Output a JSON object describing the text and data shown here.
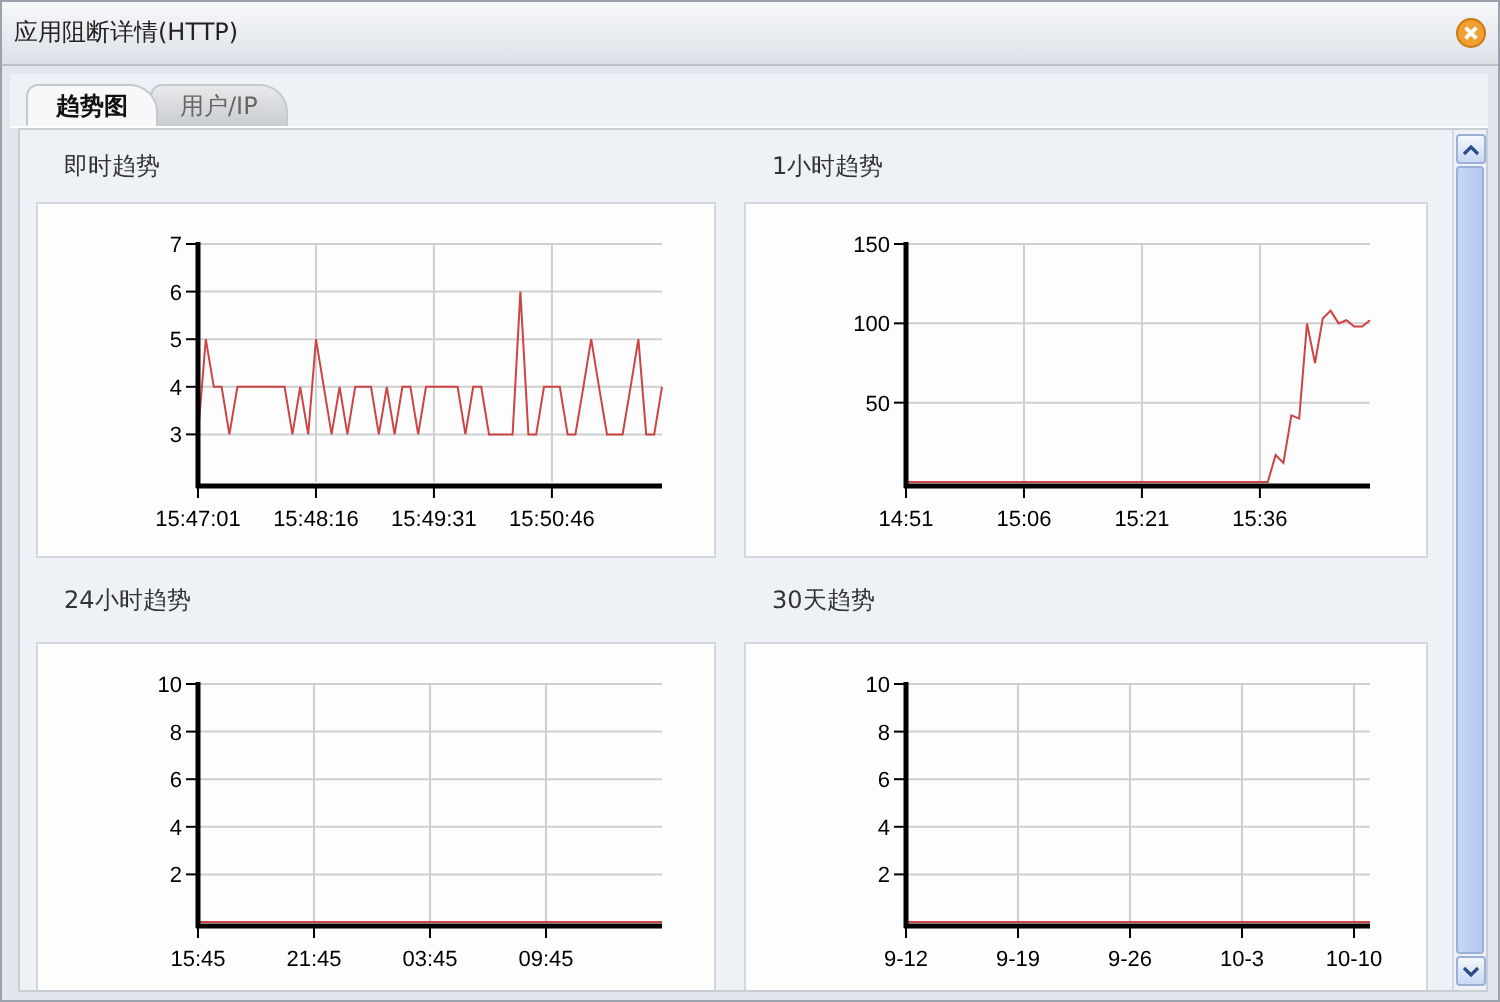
{
  "window": {
    "title": "应用阻断详情(HTTP)"
  },
  "tabs": [
    {
      "label": "趋势图",
      "selected": true
    },
    {
      "label": "用户/IP",
      "selected": false
    }
  ],
  "panels": [
    {
      "title": "即时趋势",
      "chart_data": {
        "type": "line",
        "categories": [
          "15:47:01",
          null,
          null,
          null,
          null,
          null,
          null,
          null,
          null,
          null,
          null,
          null,
          null,
          null,
          null,
          "15:48:16",
          null,
          null,
          null,
          null,
          null,
          null,
          null,
          null,
          null,
          null,
          null,
          null,
          null,
          null,
          "15:49:31",
          null,
          null,
          null,
          null,
          null,
          null,
          null,
          null,
          null,
          null,
          null,
          null,
          null,
          null,
          "15:50:46",
          null,
          null,
          null,
          null,
          null,
          null,
          null,
          null,
          null,
          null,
          null,
          null,
          null,
          null
        ],
        "series": [
          {
            "color": "#cc4444",
            "values": [
              3,
              5,
              4,
              4,
              3,
              4,
              4,
              4,
              4,
              4,
              4,
              4,
              3,
              4,
              3,
              5,
              4,
              3,
              4,
              3,
              4,
              4,
              4,
              3,
              4,
              3,
              4,
              4,
              3,
              4,
              4,
              4,
              4,
              4,
              3,
              4,
              4,
              3,
              3,
              3,
              3,
              6,
              3,
              3,
              4,
              4,
              4,
              3,
              3,
              4,
              5,
              4,
              3,
              3,
              3,
              4,
              5,
              3,
              3,
              4
            ]
          }
        ],
        "ylim": [
          2,
          7
        ],
        "yticks": [
          3,
          4,
          5,
          6,
          7
        ],
        "grid": true
      }
    },
    {
      "title": "1小时趋势",
      "chart_data": {
        "type": "line",
        "categories": [
          "14:51",
          null,
          null,
          null,
          null,
          null,
          null,
          null,
          null,
          null,
          null,
          null,
          null,
          null,
          null,
          "15:06",
          null,
          null,
          null,
          null,
          null,
          null,
          null,
          null,
          null,
          null,
          null,
          null,
          null,
          null,
          "15:21",
          null,
          null,
          null,
          null,
          null,
          null,
          null,
          null,
          null,
          null,
          null,
          null,
          null,
          null,
          "15:36",
          null,
          null,
          null,
          null,
          null,
          null,
          null,
          null,
          null,
          null,
          null,
          null,
          null,
          null
        ],
        "series": [
          {
            "color": "#cc4444",
            "values": [
              0,
              0,
              0,
              0,
              0,
              0,
              0,
              0,
              0,
              0,
              0,
              0,
              0,
              0,
              0,
              0,
              0,
              0,
              0,
              0,
              0,
              0,
              0,
              0,
              0,
              0,
              0,
              0,
              0,
              0,
              0,
              0,
              0,
              0,
              0,
              0,
              0,
              0,
              0,
              0,
              0,
              0,
              0,
              0,
              0,
              0,
              0,
              17,
              12,
              42,
              40,
              100,
              75,
              103,
              108,
              100,
              102,
              98,
              98,
              102
            ]
          }
        ],
        "ylim": [
          0,
          150
        ],
        "yticks": [
          50,
          100,
          150
        ],
        "grid": true
      }
    },
    {
      "title": "24小时趋势",
      "chart_data": {
        "type": "line",
        "categories": [
          "15:45",
          null,
          null,
          null,
          null,
          null,
          "21:45",
          null,
          null,
          null,
          null,
          null,
          "03:45",
          null,
          null,
          null,
          null,
          null,
          "09:45",
          null,
          null,
          null,
          null,
          null,
          null
        ],
        "series": [
          {
            "color": "#cc4444",
            "values": [
              0,
              0,
              0,
              0,
              0,
              0,
              0,
              0,
              0,
              0,
              0,
              0,
              0,
              0,
              0,
              0,
              0,
              0,
              0,
              0,
              0,
              0,
              0,
              0,
              0
            ]
          }
        ],
        "ylim": [
          0,
          10
        ],
        "yticks": [
          2,
          4,
          6,
          8,
          10
        ],
        "grid": true
      }
    },
    {
      "title": "30天趋势",
      "chart_data": {
        "type": "line",
        "categories": [
          "9-12",
          null,
          null,
          null,
          null,
          null,
          null,
          "9-19",
          null,
          null,
          null,
          null,
          null,
          null,
          "9-26",
          null,
          null,
          null,
          null,
          null,
          null,
          "10-3",
          null,
          null,
          null,
          null,
          null,
          null,
          "10-10",
          null
        ],
        "series": [
          {
            "color": "#cc4444",
            "values": [
              0,
              0,
              0,
              0,
              0,
              0,
              0,
              0,
              0,
              0,
              0,
              0,
              0,
              0,
              0,
              0,
              0,
              0,
              0,
              0,
              0,
              0,
              0,
              0,
              0,
              0,
              0,
              0,
              0,
              0
            ]
          }
        ],
        "ylim": [
          0,
          10
        ],
        "yticks": [
          2,
          4,
          6,
          8,
          10
        ],
        "grid": true
      }
    }
  ]
}
